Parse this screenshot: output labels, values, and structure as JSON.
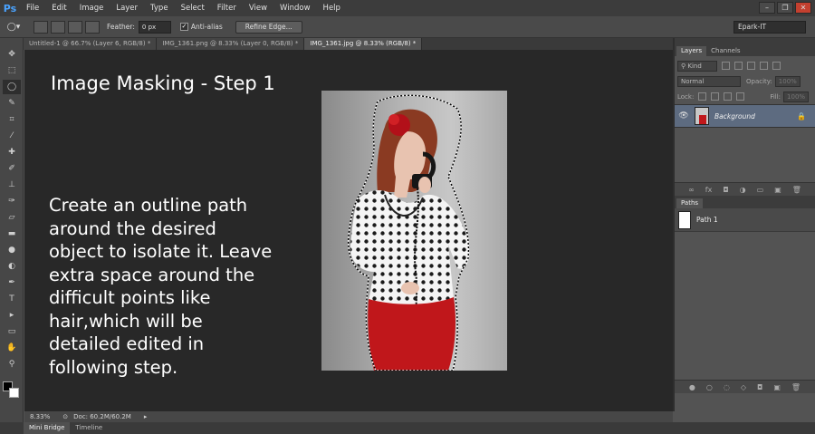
{
  "app": {
    "logo": "Ps",
    "workspace": "Epark-IT"
  },
  "menu": [
    "File",
    "Edit",
    "Image",
    "Layer",
    "Type",
    "Select",
    "Filter",
    "View",
    "Window",
    "Help"
  ],
  "window_controls": [
    "–",
    "❐",
    "✕"
  ],
  "options": {
    "feather_label": "Feather:",
    "feather_value": "0 px",
    "antialias_label": "Anti-alias",
    "antialias_checked": true,
    "refine_edge": "Refine Edge..."
  },
  "tabs": [
    {
      "label": "Untitled-1 @ 66.7% (Layer 6, RGB/8) *",
      "active": false
    },
    {
      "label": "IMG_1361.png @ 8.33% (Layer 0, RGB/8) *",
      "active": false
    },
    {
      "label": "IMG_1361.jpg @ 8.33% (RGB/8) *",
      "active": true
    }
  ],
  "canvas": {
    "heading": "Image Masking - Step 1",
    "instructions": "Create an outline path around the desired object to isolate it. Leave extra space around the difficult points like hair,which will be detailed edited in following step."
  },
  "status": {
    "zoom": "8.33%",
    "doc": "Doc: 60.2M/60.2M"
  },
  "bottom_tabs": [
    "Mini Bridge",
    "Timeline"
  ],
  "layers_panel": {
    "tabs": [
      "Layers",
      "Channels"
    ],
    "kind": "Kind",
    "blend_mode": "Normal",
    "opacity_label": "Opacity:",
    "opacity_value": "100%",
    "lock_label": "Lock:",
    "fill_label": "Fill:",
    "fill_value": "100%",
    "layer_name": "Background"
  },
  "paths_panel": {
    "tab": "Paths",
    "path_name": "Path 1"
  },
  "colors": {
    "accent": "#4aa3ff",
    "selected_layer": "#5d6b80",
    "skirt": "#c0171b"
  }
}
